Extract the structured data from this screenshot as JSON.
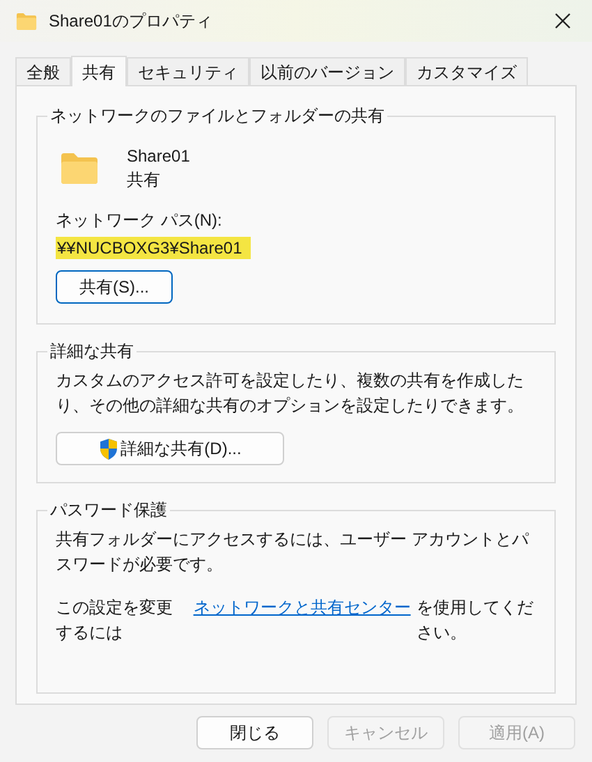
{
  "window": {
    "title": "Share01のプロパティ"
  },
  "tabs": [
    {
      "label": "全般",
      "selected": false
    },
    {
      "label": "共有",
      "selected": true
    },
    {
      "label": "セキュリティ",
      "selected": false
    },
    {
      "label": "以前のバージョン",
      "selected": false
    },
    {
      "label": "カスタマイズ",
      "selected": false
    }
  ],
  "network_sharing": {
    "title": "ネットワークのファイルとフォルダーの共有",
    "folder_name": "Share01",
    "folder_status": "共有",
    "path_label": "ネットワーク パス(N):",
    "path": "¥¥NUCBOXG3¥Share01",
    "button": "共有(S)..."
  },
  "advanced_sharing": {
    "title": "詳細な共有",
    "description": "カスタムのアクセス許可を設定したり、複数の共有を作成したり、その他の詳細な共有のオプションを設定したりできます。",
    "button": "詳細な共有(D)..."
  },
  "password_protection": {
    "title": "パスワード保護",
    "description": "共有フォルダーにアクセスするには、ユーザー アカウントとパスワードが必要です。",
    "link_before": "この設定を変更するには",
    "link": "ネットワークと共有センター",
    "link_after": "を使用してください。"
  },
  "buttons": [
    {
      "label": "閉じる",
      "disabled": false
    },
    {
      "label": "キャンセル",
      "disabled": true
    },
    {
      "label": "適用(A)",
      "disabled": true
    }
  ]
}
